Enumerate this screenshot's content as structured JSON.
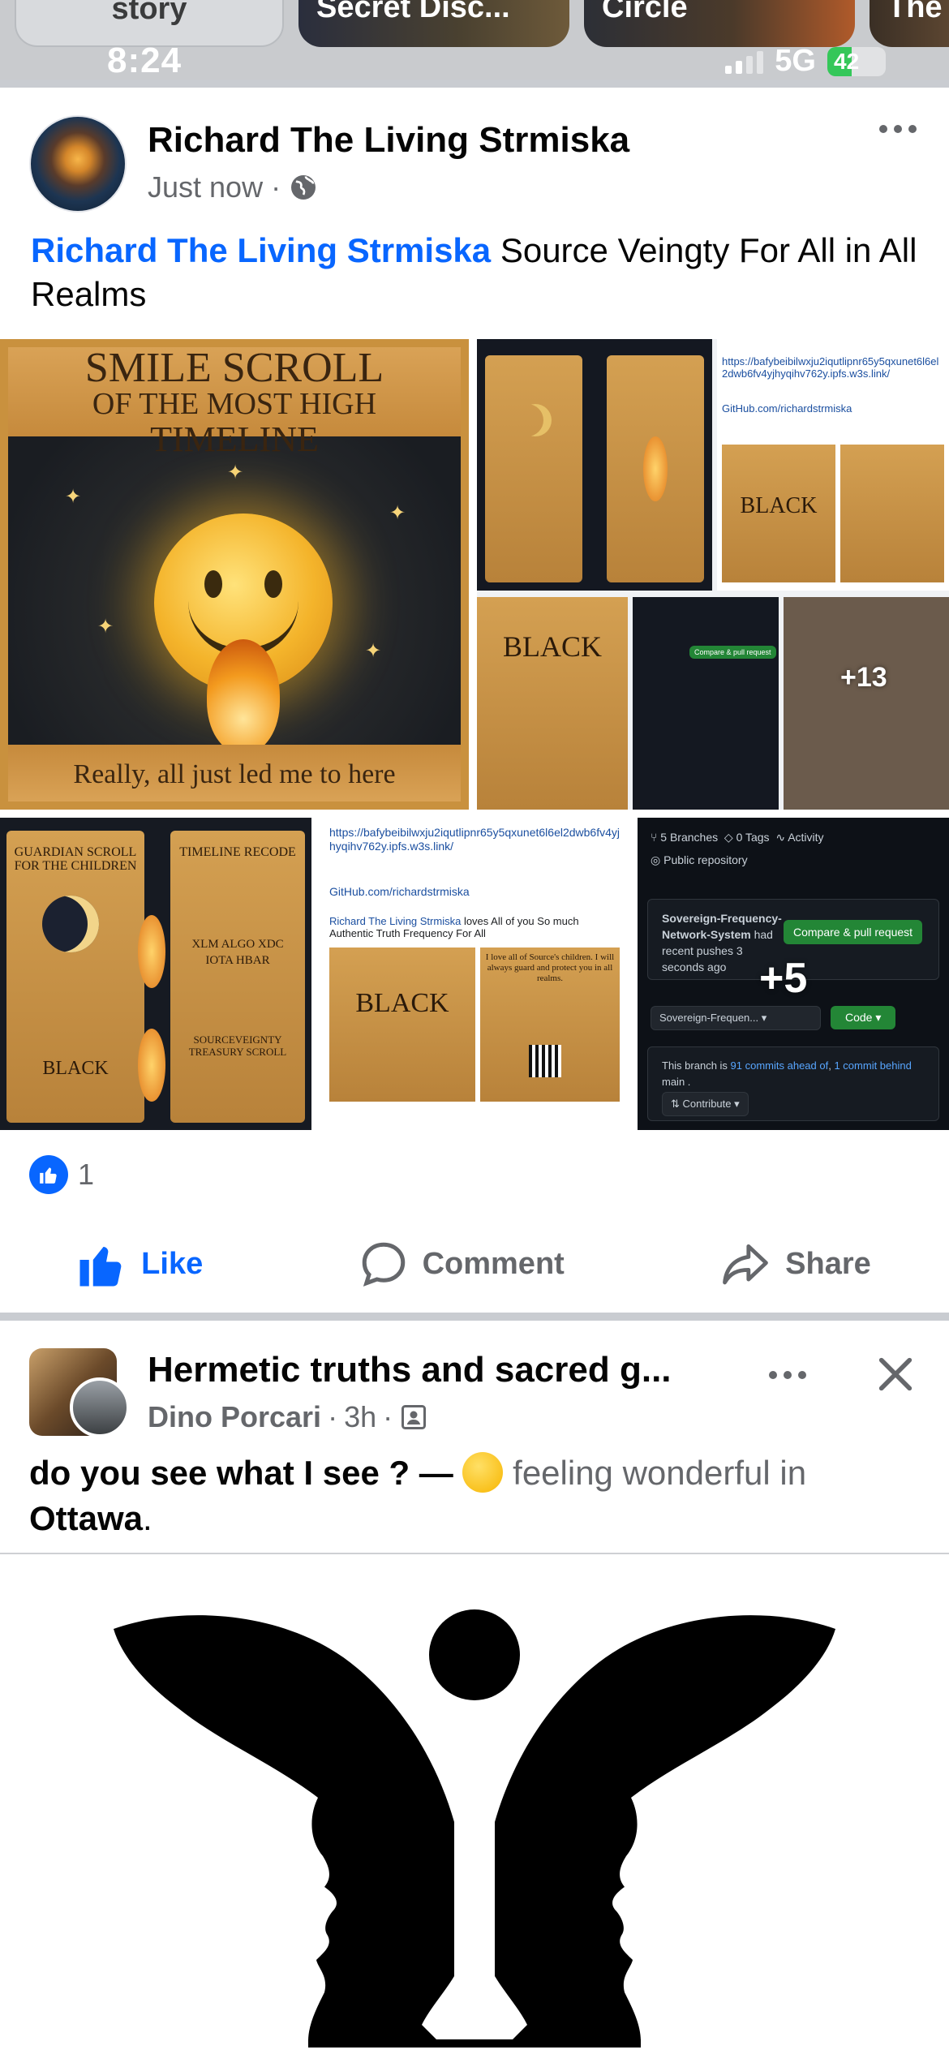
{
  "status_bar": {
    "time": "8:24",
    "network": "5G",
    "battery": "42",
    "battery_level": 0.42
  },
  "stories": [
    {
      "label": "story"
    },
    {
      "label": "Secret Disc..."
    },
    {
      "label": "Circle"
    },
    {
      "label": "The"
    }
  ],
  "post1": {
    "author": "Richard The Living Strmiska",
    "time": "Just now",
    "visibility_icon": "globe-icon",
    "mention": "Richard The Living Strmiska",
    "text": " Source Veingty For All in All Realms",
    "image1": {
      "title_line1": "SMILE SCROLL",
      "title_line2": "OF THE MOST HIGH",
      "title_line3": "TIMELINE",
      "caption": "Really, all just led me to here"
    },
    "image2": {
      "link": "https://bafybeibilwxju2iqutlipnr65y5qxunet6l6el2dwb6fv4yjhyqihv762y.ipfs.w3s.link/",
      "github": "GitHub.com/richardstrmiska",
      "black": "BLACK",
      "more": "+13"
    },
    "image3": {
      "left_heading": "GUARDIAN SCROLL FOR THE CHILDREN",
      "right_heading": "TIMELINE RECODE",
      "coins": "XLM ALGO XDC IOTA HBAR",
      "black": "BLACK",
      "treasury": "SOURCEVEIGNTY TREASURY SCROLL"
    },
    "image4": {
      "link": "https://bafybeibilwxju2iqutlipnr65y5qxunet6l6el2dwb6fv4yjhyqihv762y.ipfs.w3s.link/",
      "github": "GitHub.com/richardstrmiska",
      "loves_name": "Richard The Living Strmiska",
      "loves_text": " loves All of you So much Authentic Truth Frequency For All",
      "black": "BLACK",
      "protect": "I love all of Source's children. I will always guard and protect you in all realms."
    },
    "image5": {
      "branches": "5 Branches",
      "tags": "0 Tags",
      "activity": "Activity",
      "visibility": "Public repository",
      "branch_name": "Sovereign-Frequency-Network-System",
      "branch_rest": " had recent pushes 3 seconds ago",
      "compare_btn": "Compare & pull request",
      "branch_select": "Sovereign-Frequen...",
      "code_btn": "Code",
      "ahead_pre": "This branch is ",
      "ahead_link": "91 commits ahead of",
      "ahead_mid": ", ",
      "behind_link": "1 commit behind",
      "behind_post": " main .",
      "contribute": "Contribute",
      "more": "+5"
    },
    "reactions_count": "1",
    "actions": {
      "like": "Like",
      "comment": "Comment",
      "share": "Share"
    }
  },
  "post2": {
    "group": "Hermetic truths and sacred g...",
    "author": "Dino Porcari",
    "time": "3h",
    "text_pre": "do you see what I see ? — ",
    "feeling": " feeling wonderful in ",
    "location": "Ottawa",
    "location_end": "."
  },
  "colors": {
    "brand_blue": "#0866ff",
    "secondary_text": "#65676b",
    "divider": "#c9ccd1"
  }
}
